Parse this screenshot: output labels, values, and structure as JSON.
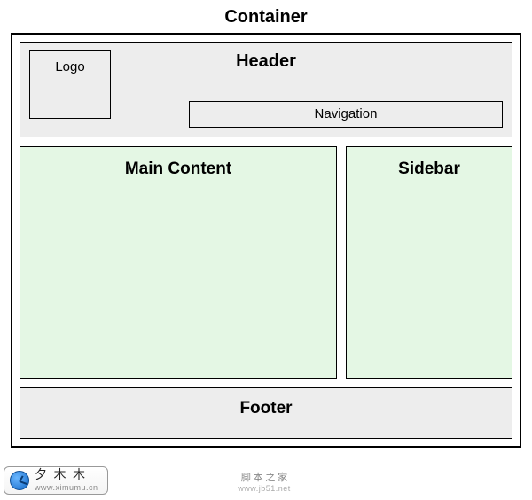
{
  "title": "Container",
  "header": {
    "label": "Header",
    "logo_label": "Logo",
    "nav_label": "Navigation"
  },
  "main": {
    "content_label": "Main Content",
    "sidebar_label": "Sidebar"
  },
  "footer": {
    "label": "Footer"
  },
  "watermarks": {
    "left_name": "夕 木 木",
    "left_url": "www.ximumu.cn",
    "center_name": "脚 本 之 家",
    "center_url": "www.jb51.net"
  }
}
